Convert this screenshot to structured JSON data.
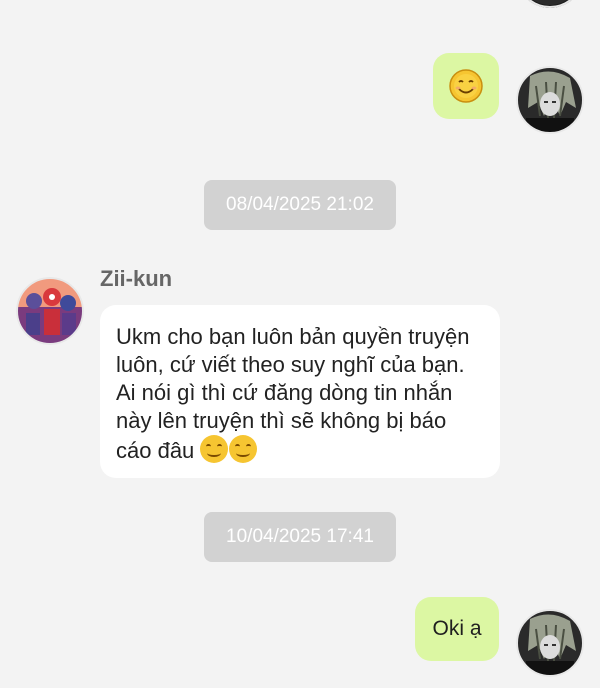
{
  "conversation": {
    "messages": [
      {
        "type": "outgoing",
        "emoji": "smiling-face-sticker"
      },
      {
        "type": "timestamp",
        "text": "08/04/2025 21:02"
      },
      {
        "type": "incoming",
        "sender": "Zii-kun",
        "lines": [
          "Ukm cho bạn luôn bản quyền truyện",
          "luôn, cứ viết theo suy nghĩ của bạn.",
          "Ai nói gì thì cứ đăng dòng tin nhắn",
          "này lên truyện thì sẽ không bị báo",
          "cáo đâu"
        ]
      },
      {
        "type": "timestamp",
        "text": "10/04/2025 17:41"
      },
      {
        "type": "outgoing",
        "text": "Oki ạ"
      }
    ]
  },
  "colors": {
    "background": "#f3f3f3",
    "outgoing_bubble": "#dcf7a3",
    "incoming_bubble": "#ffffff",
    "timestamp_bg": "#d2d2d2"
  }
}
